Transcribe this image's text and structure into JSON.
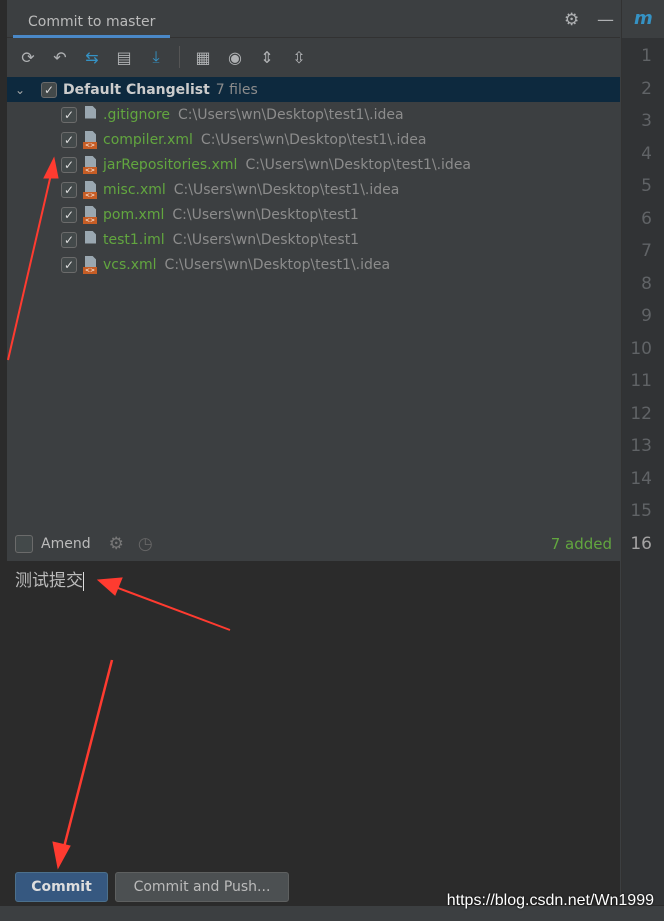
{
  "header": {
    "tab_title": "Commit to master",
    "settings_icon": "gear-icon",
    "minimize_icon": "minus-icon"
  },
  "toolbar": [
    "refresh-icon",
    "rollback-icon",
    "diff-icon",
    "changelist-icon",
    "update-icon",
    "group-by-icon",
    "view-options-icon",
    "expand-all-icon",
    "collapse-all-icon"
  ],
  "changelist": {
    "name": "Default Changelist",
    "count": "7 files",
    "checked": true,
    "files": [
      {
        "name": ".gitignore",
        "path": "C:\\Users\\wn\\Desktop\\test1\\.idea",
        "type": "ignore"
      },
      {
        "name": "compiler.xml",
        "path": "C:\\Users\\wn\\Desktop\\test1\\.idea",
        "type": "xml"
      },
      {
        "name": "jarRepositories.xml",
        "path": "C:\\Users\\wn\\Desktop\\test1\\.idea",
        "type": "xml"
      },
      {
        "name": "misc.xml",
        "path": "C:\\Users\\wn\\Desktop\\test1\\.idea",
        "type": "xml"
      },
      {
        "name": "pom.xml",
        "path": "C:\\Users\\wn\\Desktop\\test1",
        "type": "xml"
      },
      {
        "name": "test1.iml",
        "path": "C:\\Users\\wn\\Desktop\\test1",
        "type": "iml"
      },
      {
        "name": "vcs.xml",
        "path": "C:\\Users\\wn\\Desktop\\test1\\.idea",
        "type": "xml"
      }
    ]
  },
  "amend": {
    "label": "Amend",
    "checked": false,
    "status": "7 added"
  },
  "message": "测试提交",
  "buttons": {
    "commit": "Commit",
    "commit_push": "Commit and Push..."
  },
  "editor": {
    "tab": "m",
    "line_numbers": [
      "1",
      "2",
      "3",
      "4",
      "5",
      "6",
      "7",
      "8",
      "9",
      "10",
      "11",
      "12",
      "13",
      "14",
      "15",
      "16"
    ],
    "current_line": "16"
  },
  "watermark": "https://blog.csdn.net/Wn1999",
  "colors": {
    "accent": "#4a88c7",
    "added": "#62a63f",
    "selection": "#0d293e",
    "annotation": "#ff3b30"
  }
}
